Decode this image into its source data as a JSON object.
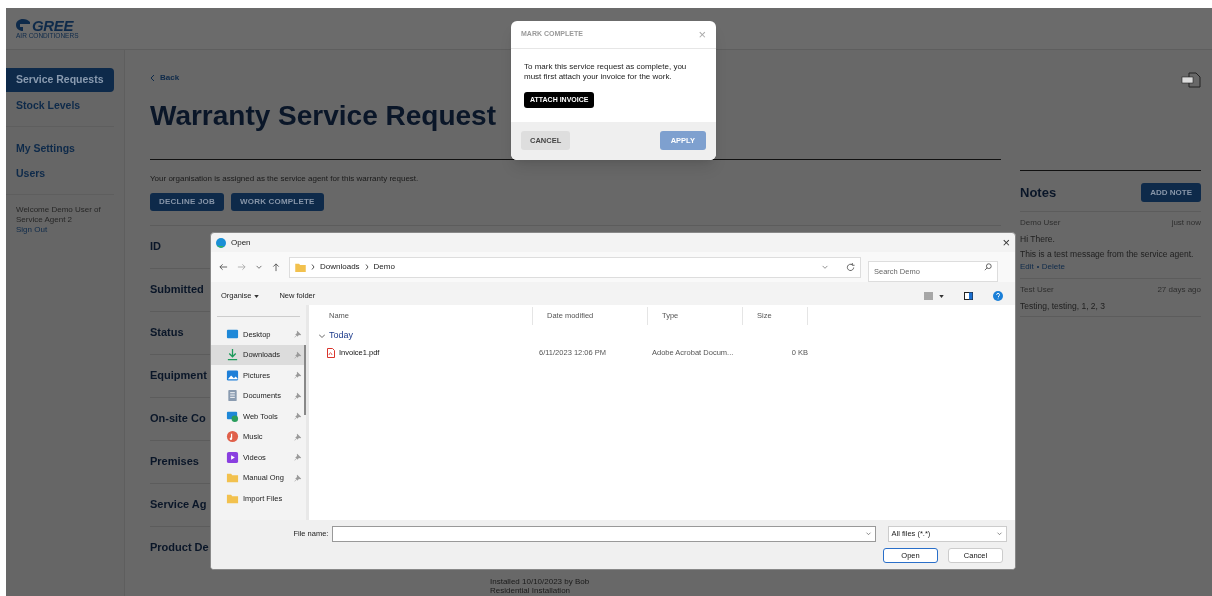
{
  "header": {
    "logo": {
      "brand": "GREE",
      "tagline": "AIR CONDITIONERS"
    }
  },
  "sidebar": {
    "groups": [
      [
        {
          "label": "Service Requests",
          "selected": true
        },
        {
          "label": "Stock Levels",
          "selected": false
        }
      ],
      [
        {
          "label": "My Settings",
          "selected": false
        },
        {
          "label": "Users",
          "selected": false
        }
      ]
    ],
    "welcome": "Welcome Demo User of Service Agent 2",
    "sign_out": "Sign Out"
  },
  "main": {
    "back": "Back",
    "title": "Warranty Service Request",
    "notice": "Your organisation is assigned as the service agent for this warranty request.",
    "actions": [
      "DECLINE JOB",
      "WORK COMPLETE"
    ],
    "rows": [
      "ID",
      "Submitted",
      "Status",
      "Equipment",
      "On-site Co",
      "Premises",
      "Service Ag",
      "Product De"
    ],
    "product_lines": [
      "Installed 10/10/2023 by Bob",
      "Residential Installation"
    ]
  },
  "notes": {
    "title": "Notes",
    "add_button": "ADD NOTE",
    "items": [
      {
        "author": "Demo User",
        "time": "just now",
        "lines": [
          "Hi There.",
          "This is a test message from the service agent."
        ],
        "links": [
          "Edit",
          "Delete"
        ]
      },
      {
        "author": "Test User",
        "time": "27 days ago",
        "lines": [
          "Testing, testing, 1, 2, 3"
        ]
      }
    ]
  },
  "mark_complete": {
    "title": "MARK COMPLETE",
    "close": "×",
    "message": "To mark this service request as complete, you must first attach your invoice for the work.",
    "attach_button": "ATTACH INVOICE",
    "cancel": "CANCEL",
    "apply": {
      "label": "APPLY",
      "disabled": true
    }
  },
  "open_dialog": {
    "title": "Open",
    "close": "×",
    "path": [
      "Downloads",
      "Demo"
    ],
    "search_placeholder": "Search Demo",
    "organise": "Organise",
    "new_folder": "New folder",
    "nav": [
      {
        "label": "Desktop",
        "kind": "desktop",
        "selected": false,
        "pinned": true
      },
      {
        "label": "Downloads",
        "kind": "downloads",
        "selected": true,
        "pinned": true
      },
      {
        "label": "Pictures",
        "kind": "pictures",
        "selected": false,
        "pinned": true
      },
      {
        "label": "Documents",
        "kind": "documents",
        "selected": false,
        "pinned": true
      },
      {
        "label": "Web Tools",
        "kind": "web",
        "selected": false,
        "pinned": true
      },
      {
        "label": "Music",
        "kind": "music",
        "selected": false,
        "pinned": true
      },
      {
        "label": "Videos",
        "kind": "videos",
        "selected": false,
        "pinned": true
      },
      {
        "label": "Manual Ong",
        "kind": "folder",
        "selected": false,
        "pinned": true
      },
      {
        "label": "Import Files",
        "kind": "folder",
        "selected": false,
        "pinned": false
      }
    ],
    "columns": [
      "Name",
      "Date modified",
      "Type",
      "Size"
    ],
    "groups": [
      {
        "label": "Today",
        "expanded": true,
        "files": [
          {
            "name": "Invoice1.pdf",
            "date": "6/11/2023 12:06 PM",
            "type": "Adobe Acrobat Docum...",
            "size": "0 KB"
          }
        ]
      }
    ],
    "file_name_label": "File name:",
    "file_type": "All files (*.*)",
    "open": "Open",
    "cancel": "Cancel"
  }
}
